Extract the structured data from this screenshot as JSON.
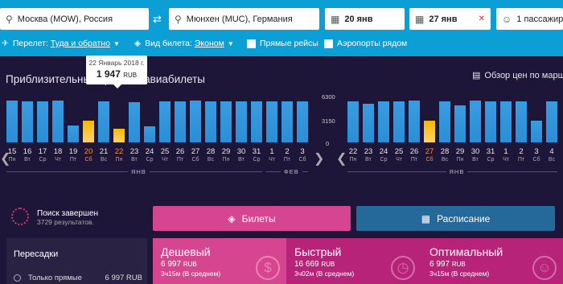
{
  "search": {
    "origin": "Москва (MOW), Россия",
    "destination": "Мюнхен (MUC), Германия",
    "depart": "20 янв",
    "return": "27 янв",
    "passengers": "1 пассажир"
  },
  "options": {
    "trip_prefix": "Перелет:",
    "trip_value": "Туда и обратно",
    "class_prefix": "Вид билета:",
    "class_value": "Эконом",
    "direct_label": "Прямые рейсы",
    "nearby_label": "Аэропорты рядом"
  },
  "prices": {
    "title": "Приблизительные цены на авиабилеты",
    "overview_link": "Обзор цен по маршруту",
    "tooltip": {
      "date": "22 Январь 2018 г.",
      "price": "1 947",
      "currency": "RUB"
    },
    "axis_ticks": [
      "6300",
      "3150",
      "0"
    ],
    "colors": {
      "bar": "#2a8fd6",
      "highlight": "#f5b800",
      "selected": "#ffb000"
    }
  },
  "chart_data": [
    {
      "type": "bar",
      "categories": [
        "15",
        "16",
        "17",
        "18",
        "19",
        "20",
        "21",
        "22",
        "23",
        "24",
        "25",
        "26",
        "27",
        "28",
        "29",
        "30",
        "31",
        "1",
        "2",
        "3"
      ],
      "weekdays": [
        "Пн",
        "Вт",
        "Ср",
        "Чт",
        "Пт",
        "Сб",
        "Вс",
        "Пн",
        "Вт",
        "Ср",
        "Чт",
        "Пт",
        "Сб",
        "Вс",
        "Пн",
        "Вт",
        "Ср",
        "Чт",
        "Пт",
        "Сб"
      ],
      "months": [
        "ЯНВ",
        "ФЕВ"
      ],
      "values": [
        5800,
        5700,
        5700,
        5800,
        2400,
        3000,
        5700,
        1947,
        5600,
        2300,
        5700,
        5700,
        5800,
        5700,
        5700,
        5700,
        5700,
        5700,
        5700,
        5700
      ],
      "highlight": [
        5,
        7
      ],
      "ylim": [
        0,
        6300
      ]
    },
    {
      "type": "bar",
      "categories": [
        "22",
        "23",
        "24",
        "25",
        "26",
        "27",
        "28",
        "29",
        "30",
        "31",
        "1",
        "2",
        "3",
        "4"
      ],
      "weekdays": [
        "Пн",
        "Вт",
        "Ср",
        "Чт",
        "Пт",
        "Сб",
        "Вс",
        "Пн",
        "Вт",
        "Ср",
        "Чт",
        "Пт",
        "Сб",
        "Вс"
      ],
      "months": [
        "ЯНВ"
      ],
      "values": [
        5700,
        5400,
        5700,
        5700,
        5800,
        3000,
        5700,
        5200,
        5800,
        5700,
        5700,
        5700,
        3000,
        5700
      ],
      "highlight": [
        5
      ],
      "ylim": [
        0,
        6300
      ]
    }
  ],
  "status": {
    "title": "Поиск завершен",
    "subtitle": "3729 результатов."
  },
  "tabs": {
    "tickets": "Билеты",
    "schedule": "Расписание"
  },
  "filters": {
    "title": "Пересадки",
    "direct_only": "Только прямые",
    "direct_price": "6 997 RUB"
  },
  "sort_cards": [
    {
      "name": "Дешевый",
      "price": "6 997",
      "currency": "RUB",
      "duration": "3ч15м (В среднем)"
    },
    {
      "name": "Быстрый",
      "price": "16 669",
      "currency": "RUB",
      "duration": "3ч02м (В среднем)"
    },
    {
      "name": "Оптимальный",
      "price": "6 997",
      "currency": "RUB",
      "duration": "3ч15м (В среднем)"
    }
  ]
}
